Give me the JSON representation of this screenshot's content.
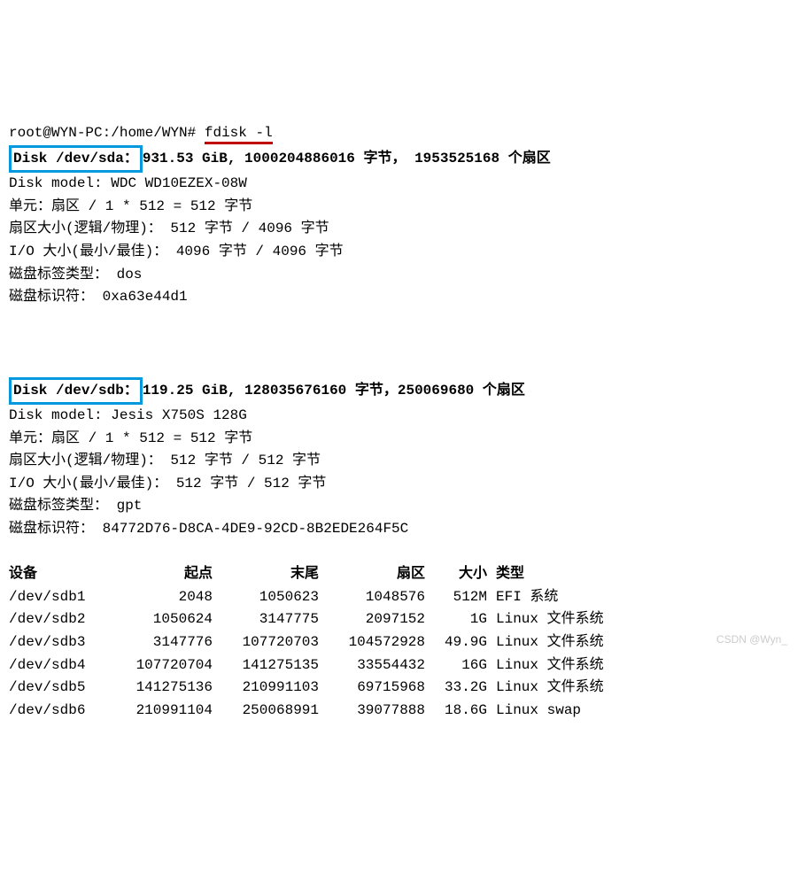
{
  "prompt": {
    "user_host": "root@WYN-PC",
    "path": "/home/WYN",
    "prompt_char": "#",
    "command": "fdisk -l"
  },
  "disk_sda": {
    "label": "Disk /dev/sda：",
    "size_line": "931.53 GiB, 1000204886016 字节， 1953525168 个扇区",
    "model_label": "Disk model:",
    "model": "WDC WD10EZEX-08W",
    "unit_line": "单元：扇区 / 1 * 512 = 512 字节",
    "sector_size_line": "扇区大小(逻辑/物理)： 512 字节 / 4096 字节",
    "io_size_line": "I/O 大小(最小/最佳)： 4096 字节 / 4096 字节",
    "label_type_line": "磁盘标签类型： dos",
    "identifier_line": "磁盘标识符： 0xa63e44d1"
  },
  "disk_sdb": {
    "label": "Disk /dev/sdb：",
    "size_line": "119.25 GiB, 128035676160 字节，250069680 个扇区",
    "model_label": "Disk model:",
    "model": "Jesis X750S 128G",
    "unit_line": "单元：扇区 / 1 * 512 = 512 字节",
    "sector_size_line": "扇区大小(逻辑/物理)： 512 字节 / 512 字节",
    "io_size_line": "I/O 大小(最小/最佳)： 512 字节 / 512 字节",
    "label_type_line": "磁盘标签类型： gpt",
    "identifier_line": "磁盘标识符： 84772D76-D8CA-4DE9-92CD-8B2EDE264F5C"
  },
  "table": {
    "headers": {
      "device": "设备",
      "start": "起点",
      "end": "末尾",
      "sectors": "扇区",
      "size": "大小",
      "type": "类型"
    },
    "rows": [
      {
        "device": "/dev/sdb1",
        "start": "2048",
        "end": "1050623",
        "sectors": "1048576",
        "size": "512M",
        "type": "EFI 系统"
      },
      {
        "device": "/dev/sdb2",
        "start": "1050624",
        "end": "3147775",
        "sectors": "2097152",
        "size": "1G",
        "type": "Linux 文件系统"
      },
      {
        "device": "/dev/sdb3",
        "start": "3147776",
        "end": "107720703",
        "sectors": "104572928",
        "size": "49.9G",
        "type": "Linux 文件系统"
      },
      {
        "device": "/dev/sdb4",
        "start": "107720704",
        "end": "141275135",
        "sectors": "33554432",
        "size": "16G",
        "type": "Linux 文件系统"
      },
      {
        "device": "/dev/sdb5",
        "start": "141275136",
        "end": "210991103",
        "sectors": "69715968",
        "size": "33.2G",
        "type": "Linux 文件系统"
      },
      {
        "device": "/dev/sdb6",
        "start": "210991104",
        "end": "250068991",
        "sectors": "39077888",
        "size": "18.6G",
        "type": "Linux swap"
      }
    ]
  },
  "watermark": "CSDN @Wyn_"
}
